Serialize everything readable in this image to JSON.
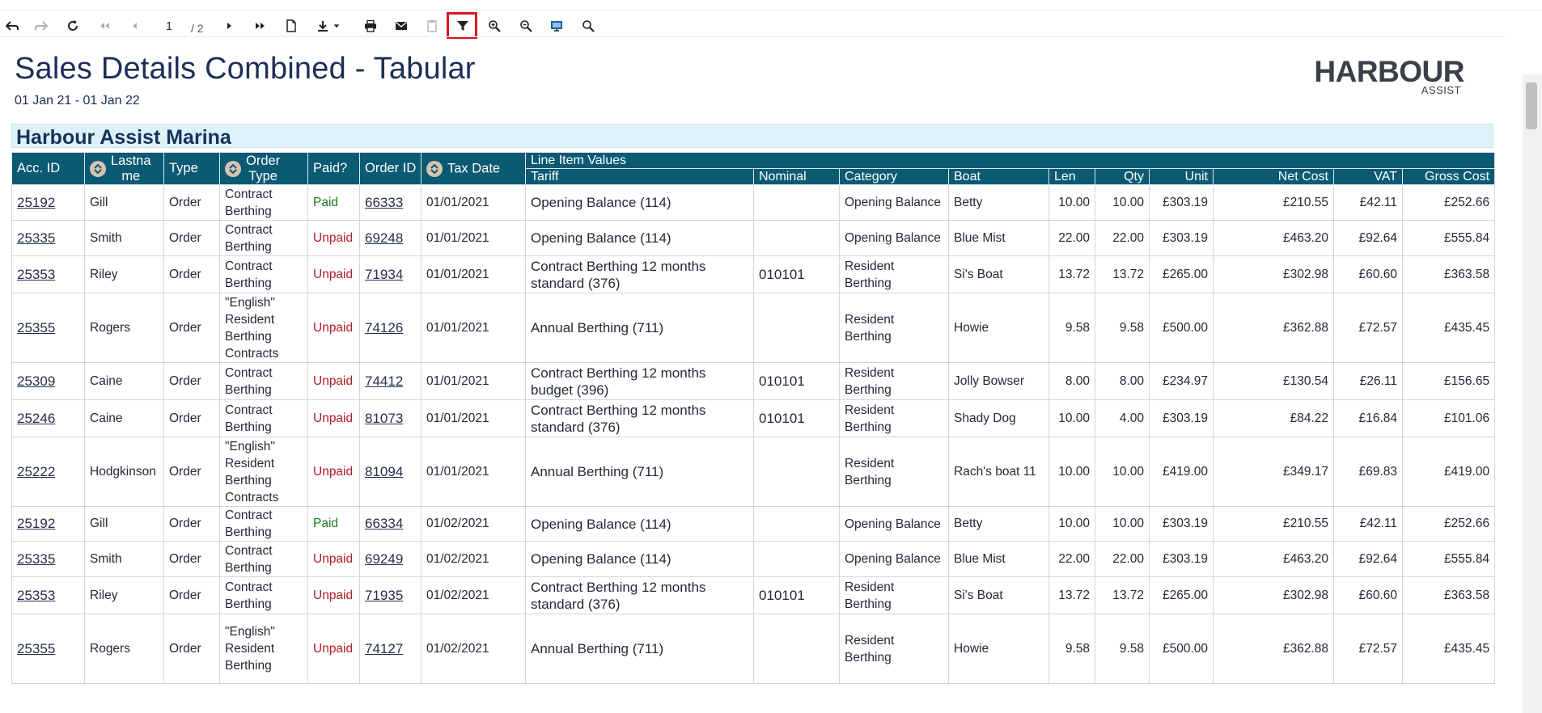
{
  "toolbar": {
    "page_current": "1",
    "page_total": "/ 2",
    "icons": [
      "back-icon",
      "forward-icon",
      "refresh-icon",
      "first-page-icon",
      "previous-page-icon",
      "next-page-icon",
      "last-page-icon",
      "document-icon",
      "download-icon",
      "print-icon",
      "email-icon",
      "clipboard-icon",
      "filter-icon",
      "zoom-in-icon",
      "zoom-out-icon",
      "screen-icon",
      "search-icon"
    ],
    "highlight_color": "#d8171d"
  },
  "report": {
    "title": "Sales Details Combined - Tabular",
    "date_range": "01 Jan 21 - 01 Jan 22",
    "logo_main": "HARBOUR",
    "logo_sub": "ASSIST"
  },
  "group": {
    "name": "Harbour Assist Marina"
  },
  "columns": {
    "acc_id": "Acc. ID",
    "lastname_a": "Lastna",
    "lastname_b": "me",
    "type": "Type",
    "order_type_a": "Order",
    "order_type_b": "Type",
    "paid": "Paid?",
    "order_id": "Order ID",
    "tax_date": "Tax Date",
    "line_item_values": "Line Item Values",
    "tariff": "Tariff",
    "nominal": "Nominal",
    "category": "Category",
    "boat": "Boat",
    "len": "Len",
    "qty": "Qty",
    "unit": "Unit",
    "net_cost": "Net Cost",
    "vat": "VAT",
    "gross_cost": "Gross Cost"
  },
  "rows": [
    {
      "acc": "25192",
      "last": "Gill",
      "type": "Order",
      "otype": [
        "Contract",
        "Berthing"
      ],
      "paid": "Paid",
      "order": "66333",
      "date": "01/01/2021",
      "tariff": [
        "Opening Balance (114)"
      ],
      "nominal": "",
      "category": [
        "Opening Balance"
      ],
      "boat": "Betty",
      "len": "10.00",
      "qty": "10.00",
      "unit": "£303.19",
      "net": "£210.55",
      "vat": "£42.11",
      "gross": "£252.66"
    },
    {
      "acc": "25335",
      "last": "Smith",
      "type": "Order",
      "otype": [
        "Contract",
        "Berthing"
      ],
      "paid": "Unpaid",
      "order": "69248",
      "date": "01/01/2021",
      "tariff": [
        "Opening Balance (114)"
      ],
      "nominal": "",
      "category": [
        "Opening Balance"
      ],
      "boat": "Blue Mist",
      "len": "22.00",
      "qty": "22.00",
      "unit": "£303.19",
      "net": "£463.20",
      "vat": "£92.64",
      "gross": "£555.84"
    },
    {
      "acc": "25353",
      "last": "Riley",
      "type": "Order",
      "otype": [
        "Contract",
        "Berthing"
      ],
      "paid": "Unpaid",
      "order": "71934",
      "date": "01/01/2021",
      "tariff": [
        "Contract Berthing 12 months",
        "standard (376)"
      ],
      "nominal": "010101",
      "category": [
        "Resident",
        "Berthing"
      ],
      "boat": "Si's Boat",
      "len": "13.72",
      "qty": "13.72",
      "unit": "£265.00",
      "net": "£302.98",
      "vat": "£60.60",
      "gross": "£363.58"
    },
    {
      "acc": "25355",
      "last": "Rogers",
      "type": "Order",
      "otype": [
        "\"English\"",
        "Resident",
        "Berthing",
        "Contracts"
      ],
      "paid": "Unpaid",
      "order": "74126",
      "date": "01/01/2021",
      "tariff": [
        "Annual Berthing (711)"
      ],
      "nominal": "",
      "category": [
        "Resident",
        "Berthing"
      ],
      "boat": "Howie",
      "len": "9.58",
      "qty": "9.58",
      "unit": "£500.00",
      "net": "£362.88",
      "vat": "£72.57",
      "gross": "£435.45"
    },
    {
      "acc": "25309",
      "last": "Caine",
      "type": "Order",
      "otype": [
        "Contract",
        "Berthing"
      ],
      "paid": "Unpaid",
      "order": "74412",
      "date": "01/01/2021",
      "tariff": [
        "Contract Berthing 12 months",
        "budget (396)"
      ],
      "nominal": "010101",
      "category": [
        "Resident",
        "Berthing"
      ],
      "boat": "Jolly Bowser",
      "len": "8.00",
      "qty": "8.00",
      "unit": "£234.97",
      "net": "£130.54",
      "vat": "£26.11",
      "gross": "£156.65"
    },
    {
      "acc": "25246",
      "last": "Caine",
      "type": "Order",
      "otype": [
        "Contract",
        "Berthing"
      ],
      "paid": "Unpaid",
      "order": "81073",
      "date": "01/01/2021",
      "tariff": [
        "Contract Berthing 12 months",
        "standard (376)"
      ],
      "nominal": "010101",
      "category": [
        "Resident",
        "Berthing"
      ],
      "boat": "Shady Dog",
      "len": "10.00",
      "qty": "4.00",
      "unit": "£303.19",
      "net": "£84.22",
      "vat": "£16.84",
      "gross": "£101.06"
    },
    {
      "acc": "25222",
      "last": "Hodgkinson",
      "type": "Order",
      "otype": [
        "\"English\"",
        "Resident",
        "Berthing",
        "Contracts"
      ],
      "paid": "Unpaid",
      "order": "81094",
      "date": "01/01/2021",
      "tariff": [
        "Annual Berthing (711)"
      ],
      "nominal": "",
      "category": [
        "Resident",
        "Berthing"
      ],
      "boat": "Rach's boat 11",
      "len": "10.00",
      "qty": "10.00",
      "unit": "£419.00",
      "net": "£349.17",
      "vat": "£69.83",
      "gross": "£419.00"
    },
    {
      "acc": "25192",
      "last": "Gill",
      "type": "Order",
      "otype": [
        "Contract",
        "Berthing"
      ],
      "paid": "Paid",
      "order": "66334",
      "date": "01/02/2021",
      "tariff": [
        "Opening Balance (114)"
      ],
      "nominal": "",
      "category": [
        "Opening Balance"
      ],
      "boat": "Betty",
      "len": "10.00",
      "qty": "10.00",
      "unit": "£303.19",
      "net": "£210.55",
      "vat": "£42.11",
      "gross": "£252.66"
    },
    {
      "acc": "25335",
      "last": "Smith",
      "type": "Order",
      "otype": [
        "Contract",
        "Berthing"
      ],
      "paid": "Unpaid",
      "order": "69249",
      "date": "01/02/2021",
      "tariff": [
        "Opening Balance (114)"
      ],
      "nominal": "",
      "category": [
        "Opening Balance"
      ],
      "boat": "Blue Mist",
      "len": "22.00",
      "qty": "22.00",
      "unit": "£303.19",
      "net": "£463.20",
      "vat": "£92.64",
      "gross": "£555.84"
    },
    {
      "acc": "25353",
      "last": "Riley",
      "type": "Order",
      "otype": [
        "Contract",
        "Berthing"
      ],
      "paid": "Unpaid",
      "order": "71935",
      "date": "01/02/2021",
      "tariff": [
        "Contract Berthing 12 months",
        "standard (376)"
      ],
      "nominal": "010101",
      "category": [
        "Resident",
        "Berthing"
      ],
      "boat": "Si's Boat",
      "len": "13.72",
      "qty": "13.72",
      "unit": "£265.00",
      "net": "£302.98",
      "vat": "£60.60",
      "gross": "£363.58"
    },
    {
      "acc": "25355",
      "last": "Rogers",
      "type": "Order",
      "otype": [
        "\"English\"",
        "Resident",
        "Berthing"
      ],
      "paid": "Unpaid",
      "order": "74127",
      "date": "01/02/2021",
      "tariff": [
        "Annual Berthing (711)"
      ],
      "nominal": "",
      "category": [
        "Resident",
        "Berthing"
      ],
      "boat": "Howie",
      "len": "9.58",
      "qty": "9.58",
      "unit": "£500.00",
      "net": "£362.88",
      "vat": "£72.57",
      "gross": "£435.45"
    }
  ]
}
